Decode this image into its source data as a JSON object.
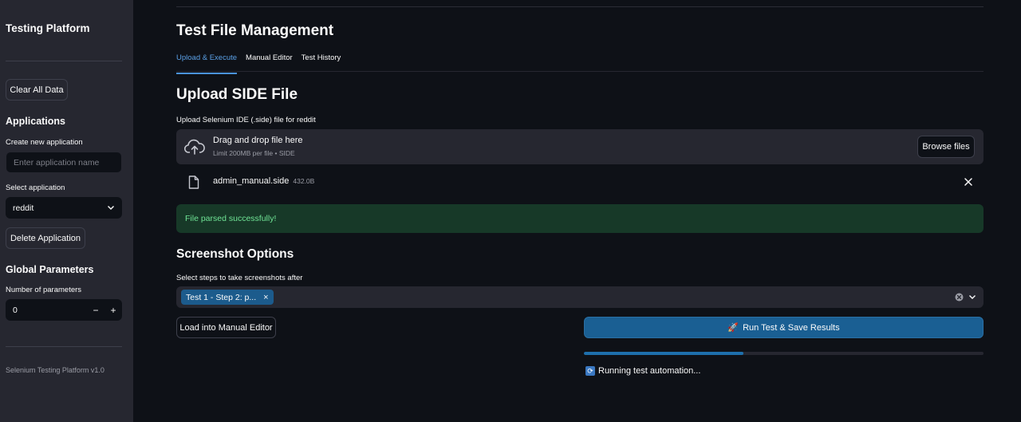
{
  "sidebar": {
    "title": "Testing Platform",
    "clear_button": "Clear All Data",
    "applications": {
      "heading": "Applications",
      "create_label": "Create new application",
      "create_placeholder": "Enter application name",
      "select_label": "Select application",
      "selected": "reddit",
      "delete_button": "Delete Application"
    },
    "global_params": {
      "heading": "Global Parameters",
      "count_label": "Number of parameters",
      "count_value": "0",
      "minus": "−",
      "plus": "+"
    },
    "footer": "Selenium Testing Platform v1.0"
  },
  "main": {
    "title": "Test File Management",
    "tabs": [
      {
        "label": "Upload & Execute",
        "active": true
      },
      {
        "label": "Manual Editor",
        "active": false
      },
      {
        "label": "Test History",
        "active": false
      }
    ],
    "upload": {
      "heading": "Upload SIDE File",
      "caption": "Upload Selenium IDE (.side) file for reddit",
      "drop_text": "Drag and drop file here",
      "limit_text": "Limit 200MB per file • SIDE",
      "browse_button": "Browse files",
      "file_name": "admin_manual.side",
      "file_size": "432.0B"
    },
    "success_message": "File parsed successfully!",
    "screenshot": {
      "heading": "Screenshot Options",
      "caption": "Select steps to take screenshots after",
      "chip": "Test 1 - Step 2: p...",
      "chip_close": "×"
    },
    "load_button": "Load into Manual Editor",
    "run_button": {
      "icon": "🚀",
      "label": "Run Test & Save Results"
    },
    "progress": 0.4,
    "status": {
      "icon": "refresh-icon",
      "text": "Running test automation..."
    }
  },
  "colors": {
    "background": "#0e1117",
    "sidebar": "#262730",
    "accent": "#5aa0e6",
    "primary_button": "#1a5f93",
    "success_bg": "#173928",
    "success_text": "#6fe395"
  }
}
